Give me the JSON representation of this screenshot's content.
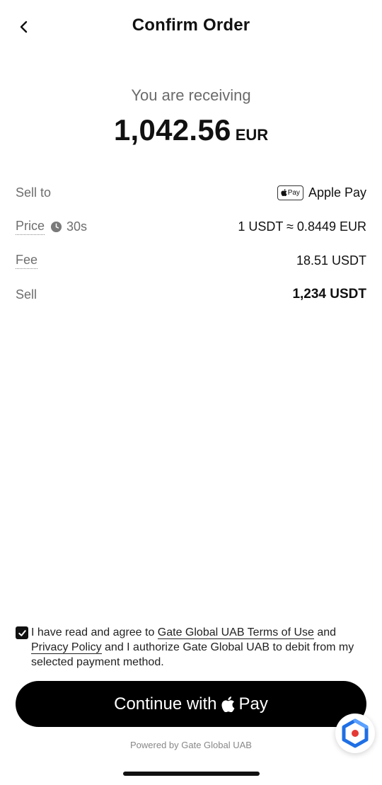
{
  "header": {
    "title": "Confirm Order"
  },
  "receive": {
    "label": "You are receiving",
    "amount": "1,042.56",
    "currency": "EUR"
  },
  "details": [
    {
      "label": "Sell to",
      "value": "Apple Pay",
      "badge": "Pay"
    },
    {
      "label": "Price",
      "timer": "30s",
      "value": "1 USDT ≈ 0.8449 EUR"
    },
    {
      "label": "Fee",
      "value": "18.51 USDT"
    },
    {
      "label": "Sell",
      "value": "1,234 USDT"
    }
  ],
  "agreement": {
    "checked": true,
    "text_1": "I have read and agree to ",
    "link_terms": "Gate Global UAB Terms of Use",
    "text_2": " and ",
    "link_privacy": "Privacy Policy",
    "text_3": " and I authorize Gate Global UAB to debit from my selected payment method."
  },
  "cta": {
    "label": "Continue with",
    "pay": "Pay"
  },
  "footer": {
    "powered": "Powered by Gate Global UAB"
  },
  "icons": {
    "back": "chevron-left-icon",
    "clock": "clock-icon",
    "apple": "apple-logo-icon",
    "check": "check-icon",
    "support": "support-logo-icon"
  },
  "colors": {
    "primary": "#000000",
    "muted": "#6e6e6e",
    "fab_blue": "#1f6fe5",
    "fab_red": "#e53935"
  }
}
